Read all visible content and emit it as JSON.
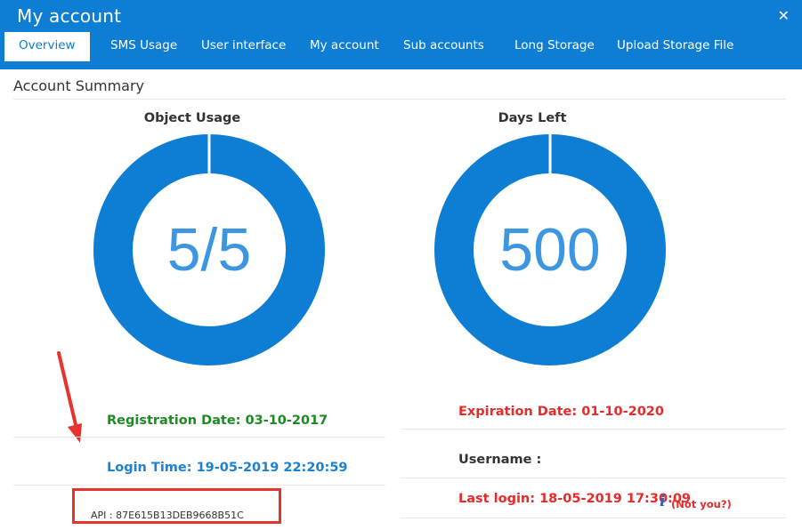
{
  "window": {
    "title": "My account",
    "close_icon": "close-icon"
  },
  "tabs": [
    {
      "label": "Overview",
      "active": true
    },
    {
      "label": "SMS Usage"
    },
    {
      "label": "User interface"
    },
    {
      "label": "My account"
    },
    {
      "label": "Sub accounts"
    },
    {
      "label": "Long Storage"
    },
    {
      "label": "Upload Storage File"
    }
  ],
  "section": {
    "title": "Account Summary"
  },
  "charts": [
    {
      "title": "Object Usage",
      "value_text": "5/5",
      "fill_fraction": 1.0
    },
    {
      "title": "Days Left",
      "value_text": "500",
      "fill_fraction": 1.0
    }
  ],
  "info": {
    "registration": "Registration Date: 03-10-2017",
    "expiration": "Expiration Date: 01-10-2020",
    "login_time": "Login Time: 19-05-2019 22:20:59",
    "username": "Username :",
    "last_login": "Last login: 18-05-2019 17:30:09",
    "not_you": "(Not you?)",
    "api": "API : 87E615B13DEB9668B51C"
  },
  "colors": {
    "brand": "#0d7ed3",
    "donut": "#0d7ed3",
    "green": "#1e8a24",
    "red": "#e52b2b",
    "annotation": "#e8322d"
  }
}
